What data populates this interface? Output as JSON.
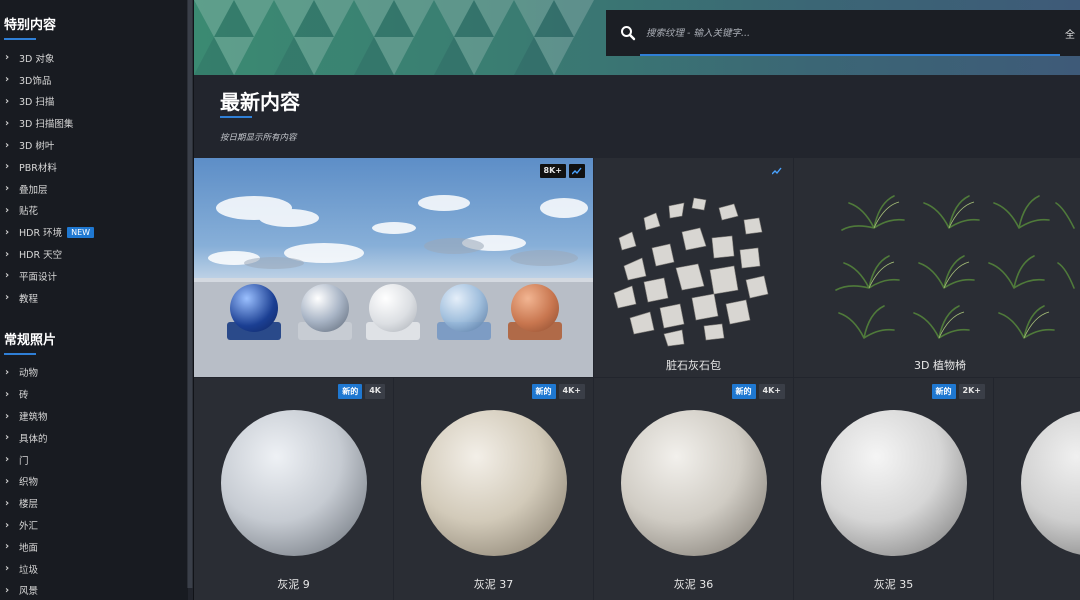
{
  "sidebar": {
    "section1_title": "特别内容",
    "section1_items": [
      {
        "label": "3D 对象"
      },
      {
        "label": "3D饰品"
      },
      {
        "label": "3D 扫描"
      },
      {
        "label": "3D 扫描图集"
      },
      {
        "label": "3D 树叶"
      },
      {
        "label": "PBR材料"
      },
      {
        "label": "叠加层"
      },
      {
        "label": "贴花"
      },
      {
        "label": "HDR 环境",
        "badge": "NEW"
      },
      {
        "label": "HDR 天空"
      },
      {
        "label": "平面设计"
      },
      {
        "label": "教程"
      }
    ],
    "section2_title": "常规照片",
    "section2_items": [
      {
        "label": "动物"
      },
      {
        "label": "砖"
      },
      {
        "label": "建筑物"
      },
      {
        "label": "具体的"
      },
      {
        "label": "门"
      },
      {
        "label": "织物"
      },
      {
        "label": "楼层"
      },
      {
        "label": "外汇"
      },
      {
        "label": "地面"
      },
      {
        "label": "垃圾"
      },
      {
        "label": "风景"
      }
    ]
  },
  "search": {
    "placeholder": "搜索纹理 - 输入关键字...",
    "scope_label": "全"
  },
  "main": {
    "title": "最新内容",
    "subtitle": "按日期显示所有内容"
  },
  "cards_top": [
    {
      "label": "",
      "tags": [
        "8K+"
      ],
      "chart_icon": true
    },
    {
      "label": "脏石灰石包",
      "tags": [],
      "chart_icon": true
    },
    {
      "label": "3D 植物椅",
      "tags": [],
      "chart_icon": false
    }
  ],
  "cards_bottom": [
    {
      "label": "灰泥 9",
      "new": "新的",
      "res": "4K"
    },
    {
      "label": "灰泥 37",
      "new": "新的",
      "res": "4K+"
    },
    {
      "label": "灰泥 36",
      "new": "新的",
      "res": "4K+"
    },
    {
      "label": "灰泥 35",
      "new": "新的",
      "res": "2K+"
    },
    {
      "label": "",
      "new": "",
      "res": ""
    }
  ],
  "colors": {
    "accent": "#2f7fd6",
    "sidebar_bg": "#181b21",
    "page_bg": "#22252d",
    "card_bg": "#2a2d34"
  }
}
